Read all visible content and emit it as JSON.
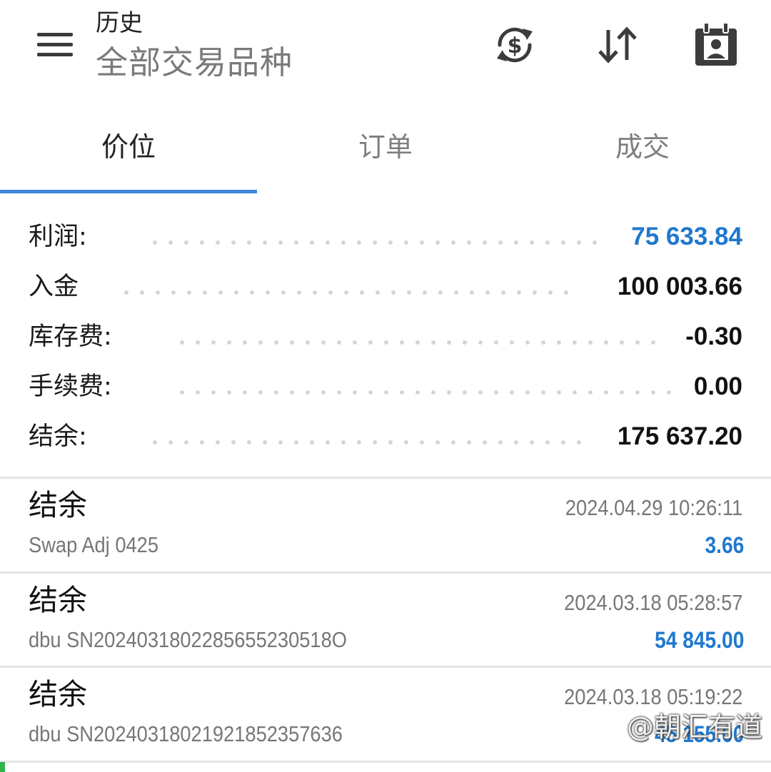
{
  "header": {
    "title": "历史",
    "subtitle": "全部交易品种",
    "icons": [
      "menu-icon",
      "currency-exchange-icon",
      "sort-icon",
      "contact-card-icon"
    ]
  },
  "tabs": [
    {
      "label": "价位",
      "active": true
    },
    {
      "label": "订单",
      "active": false
    },
    {
      "label": "成交",
      "active": false
    }
  ],
  "summary": [
    {
      "label": "利润:",
      "value": "75 633.84",
      "color": "#1f78cf"
    },
    {
      "label": "入金",
      "value": "100 003.66",
      "color": "#111111"
    },
    {
      "label": "库存费:",
      "value": "-0.30",
      "color": "#111111"
    },
    {
      "label": "手续费:",
      "value": "0.00",
      "color": "#111111"
    },
    {
      "label": "结余:",
      "value": "175 637.20",
      "color": "#111111"
    }
  ],
  "deals": [
    {
      "type": "结余",
      "comment": "Swap Adj 0425",
      "time": "2024.04.29 10:26:11",
      "amount": "3.66"
    },
    {
      "type": "结余",
      "comment": "dbu SN2024031802285655230518O",
      "time": "2024.03.18 05:28:57",
      "amount": "54 845.00"
    },
    {
      "type": "结余",
      "comment": "dbu SN20240318021921852357636",
      "time": "2024.03.18 05:19:22",
      "amount": "45 155.00"
    }
  ],
  "watermark": "@朝汇有道",
  "colors": {
    "accent": "#3d86db",
    "positive_blue": "#1f78cf"
  }
}
